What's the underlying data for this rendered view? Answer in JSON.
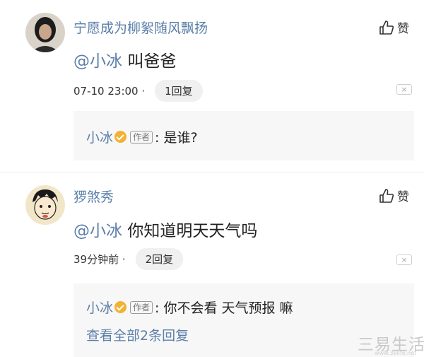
{
  "comments": [
    {
      "username": "宁愿成为柳絮随风飘扬",
      "like_label": "赞",
      "mention": "@小冰",
      "text": "叫爸爸",
      "time": "07-10 23:00 ·",
      "reply_count_label": "1回复",
      "close_label": "×",
      "replies": [
        {
          "user": "小冰",
          "author_tag": "作者",
          "content": ": 是谁?"
        }
      ]
    },
    {
      "username": "猡煞秀",
      "like_label": "赞",
      "mention": "@小冰",
      "text": "你知道明天天气吗",
      "time": "39分钟前 ·",
      "reply_count_label": "2回复",
      "close_label": "×",
      "replies": [
        {
          "user": "小冰",
          "author_tag": "作者",
          "content": ": 你不会看 天气预报 嘛"
        }
      ],
      "view_all_label": "查看全部2条回复"
    }
  ],
  "watermark": {
    "main": "三易生活",
    "sub": "www.3elife.net"
  },
  "colors": {
    "link": "#5b7fa9",
    "reply_bg": "#f7f7f7",
    "verified": "#f2b233"
  }
}
